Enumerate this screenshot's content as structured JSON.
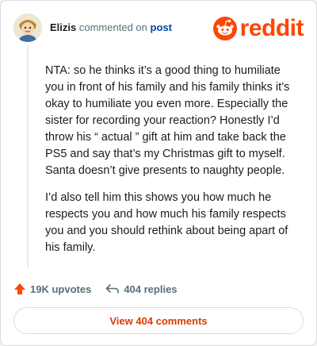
{
  "header": {
    "username": "Elizis",
    "action": "commented on",
    "target": "post",
    "logo_text": "reddit"
  },
  "comment": {
    "paragraphs": [
      "NTA: so he thinks it’s a good thing to humiliate you in front of his family and his family thinks it’s okay to humiliate you even more. Especially the sister for recording your reaction? Honestly I’d throw his “ actual ” gift at him and take back the PS5 and say that’s my Christmas gift to myself. Santa doesn’t give presents to naughty people.",
      "I’d also tell him this shows you how much he respects you and how much his family respects you and you should rethink about being apart of his family."
    ]
  },
  "footer": {
    "upvotes": "19K upvotes",
    "replies": "404 replies",
    "view_button": "View 404 comments"
  },
  "colors": {
    "accent": "#ff4500",
    "link": "#0045ac",
    "button_text": "#d93a00"
  },
  "icons": {
    "avatar": "user-avatar",
    "upvote": "upvote-arrow-icon",
    "reply": "reply-arrow-icon",
    "logo": "reddit-snoo-icon"
  }
}
